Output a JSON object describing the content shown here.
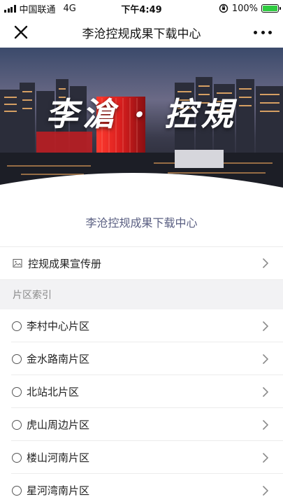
{
  "status_bar": {
    "carrier": "中国联通",
    "network": "4G",
    "time": "下午4:49",
    "battery": "100%",
    "battery_level": 1.0
  },
  "nav": {
    "title": "李沧控规成果下载中心",
    "close_icon": "close-icon",
    "more_icon": "more-icon"
  },
  "banner": {
    "caption": "李滄 · 控規"
  },
  "hero": {
    "heading": "李沧控规成果下载中心"
  },
  "brochure": {
    "icon": "image-icon",
    "label": "控规成果宣传册"
  },
  "section": {
    "header": "片区索引"
  },
  "districts": [
    {
      "label": "李村中心片区"
    },
    {
      "label": "金水路南片区"
    },
    {
      "label": "北站北片区"
    },
    {
      "label": "虎山周边片区"
    },
    {
      "label": "楼山河南片区"
    },
    {
      "label": "星河湾南片区"
    }
  ],
  "colors": {
    "heading_text": "#5a5f82",
    "battery_fill": "#2ecc40",
    "page_background": "#f2f2f4"
  }
}
